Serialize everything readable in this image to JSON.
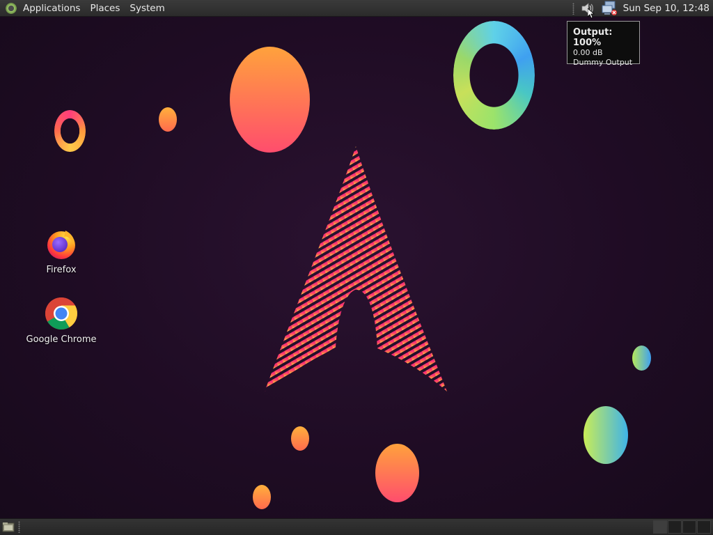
{
  "top_panel": {
    "menus": [
      "Applications",
      "Places",
      "System"
    ],
    "clock": "Sun Sep 10, 12:48"
  },
  "tray": {
    "icons": [
      "volume-icon",
      "network-icon"
    ]
  },
  "tooltip": {
    "title": "Output: 100%",
    "level": "0.00 dB",
    "device": "Dummy Output"
  },
  "desktop_icons": [
    {
      "label": "Firefox",
      "icon": "firefox-icon"
    },
    {
      "label": "Google Chrome",
      "icon": "chrome-icon"
    }
  ],
  "bottom_panel": {
    "workspaces": 4,
    "active_workspace": 1
  },
  "colors": {
    "panel": "#2f2f2f",
    "wallpaper": "#1f0c24",
    "accent_pink": "#e0306a",
    "accent_orange": "#ff9a3c"
  }
}
